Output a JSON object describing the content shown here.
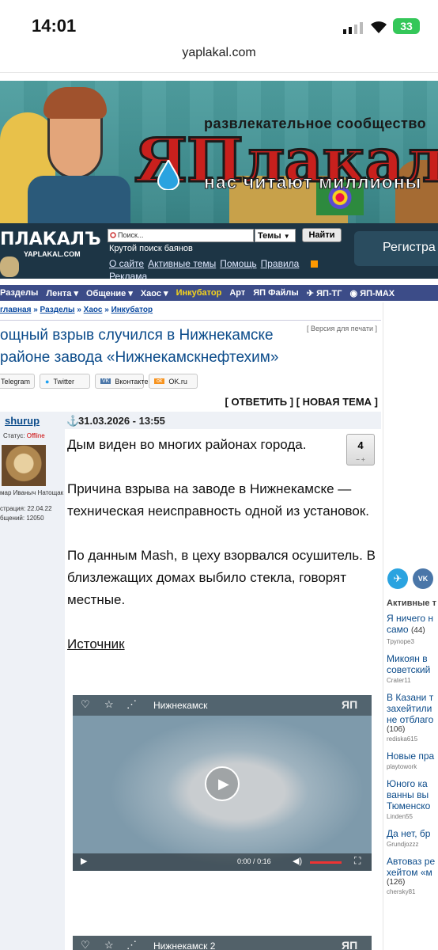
{
  "status": {
    "time": "14:01",
    "battery": "33"
  },
  "browser": {
    "url": "yaplakal.com"
  },
  "header": {
    "community": "развлекательное сообщество",
    "logo": "ЯПлакалъ",
    "slogan": "нас читают миллионы",
    "site_logo": "ПЛАКАЛЪ",
    "site_url": "YAPLAKAL.COM"
  },
  "search": {
    "placeholder": "Поиск...",
    "scope": "Темы",
    "button": "Найти",
    "hint": "Крутой поиск баянов",
    "register": "Регистра"
  },
  "toplinks": [
    "О сайте",
    "Активные темы",
    "Помощь",
    "Правила",
    "Реклама"
  ],
  "nav": [
    "Разделы",
    "Лента",
    "Общение",
    "Хаос",
    "Инкубатор",
    "Арт",
    "ЯП Файлы",
    "ЯП-ТГ",
    "ЯП-MAX"
  ],
  "breadcrumb": [
    "главная",
    "Разделы",
    "Хаос",
    "Инкубатор"
  ],
  "topic": {
    "title_line1": "ощный взрыв случился в Нижнекамске",
    "title_line2": "районе завода «Нижнекамскнефтехим»",
    "print": "[ Версия для печати ]"
  },
  "share": [
    "Telegram",
    "Twitter",
    "Вконтакте",
    "OK.ru"
  ],
  "actions": "[ ОТВЕТИТЬ ] [ НОВАЯ ТЕМА ]",
  "post": {
    "author": "shurup",
    "date": "31.03.2026 - 13:55",
    "status_label": "Статус:",
    "status": "Offline",
    "user_title": "мар Иваныч Натощак",
    "reg": "страция: 22.04.22",
    "posts": "бщений: 12050",
    "rating": "4",
    "p1": "Дым виден во многих районах города.",
    "p2": "Причина взрыва на заводе в Нижнекамске — техническая неисправность одной из установок.",
    "p3": "По данным Mash, в цеху взорвался осушитель. В близлежащих домах выбило стекла, говорят местные.",
    "source": "Источник"
  },
  "video1": {
    "title": "Нижнекамск",
    "time": "0:00",
    "sep": "/",
    "dur": "0:16"
  },
  "video2": {
    "title": "Нижнекамск 2"
  },
  "sidebar": {
    "heading": "Активные т",
    "topics": [
      {
        "l1": "Я ничего н",
        "l2": "само",
        "count": "(44)",
        "user": "Трупоре3"
      },
      {
        "l1": "Микоян в",
        "l2": "советский",
        "count": "",
        "user": "Crater11"
      },
      {
        "l1": "В Казани т",
        "l2": "захейтили",
        "l3": "не отблаго",
        "count": "(106)",
        "user": "rediska615"
      },
      {
        "l1": "Новые пра",
        "l2": "",
        "count": "",
        "user": "playtowork"
      },
      {
        "l1": "Юного ка",
        "l2": "ванны вы",
        "l3": "Тюменско",
        "count": "",
        "user": "Linden55"
      },
      {
        "l1": "Да нет, бр",
        "l2": "",
        "count": "",
        "user": "Grundjozzz"
      },
      {
        "l1": "Автоваз ре",
        "l2": "хейтом «м",
        "count": "(126)",
        "user": "chersky81"
      }
    ]
  }
}
